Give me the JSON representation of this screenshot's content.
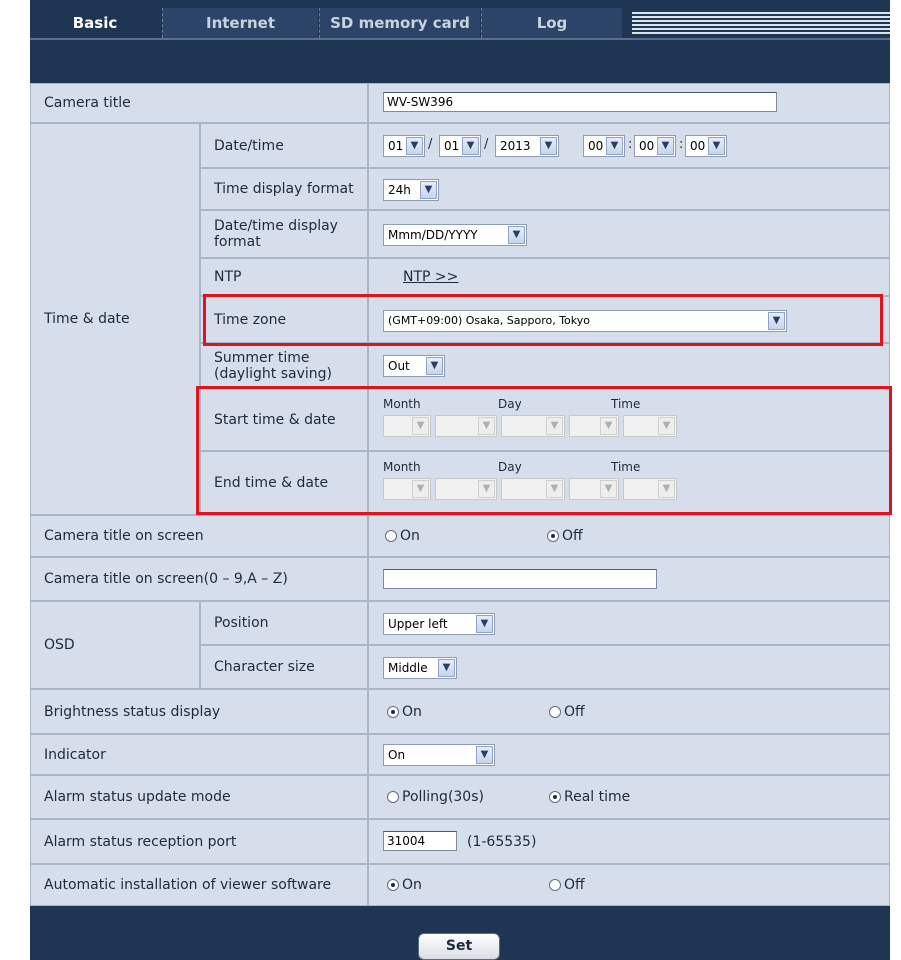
{
  "tabs": [
    "Basic",
    "Internet",
    "SD memory card",
    "Log"
  ],
  "rows": {
    "camera_title": {
      "label": "Camera title",
      "value": "WV-SW396"
    },
    "time_date": {
      "label": "Time & date",
      "datetime": {
        "label": "Date/time",
        "month": "01",
        "day": "01",
        "year": "2013",
        "hour": "00",
        "minute": "00",
        "second": "00",
        "slash": "/",
        "colon": ":"
      },
      "time_display_format": {
        "label": "Time display format",
        "value": "24h"
      },
      "datetime_display_format": {
        "label": "Date/time display format",
        "value": "Mmm/DD/YYYY"
      },
      "ntp": {
        "label": "NTP",
        "link": "NTP >>"
      },
      "time_zone": {
        "label": "Time zone",
        "value": "(GMT+09:00) Osaka, Sapporo, Tokyo"
      },
      "summer_time": {
        "label": "Summer time (daylight saving)",
        "value": "Out"
      },
      "start_time": {
        "label": "Start time & date",
        "month_label": "Month",
        "day_label": "Day",
        "time_label": "Time"
      },
      "end_time": {
        "label": "End time & date",
        "month_label": "Month",
        "day_label": "Day",
        "time_label": "Time"
      }
    },
    "title_on_screen": {
      "label": "Camera title on screen",
      "on": "On",
      "off": "Off",
      "selected": "off"
    },
    "title_on_screen_text": {
      "label": "Camera title on screen(0 – 9,A – Z)",
      "value": ""
    },
    "osd": {
      "label": "OSD",
      "position": {
        "label": "Position",
        "value": "Upper left"
      },
      "character_size": {
        "label": "Character size",
        "value": "Middle"
      }
    },
    "brightness": {
      "label": "Brightness status display",
      "on": "On",
      "off": "Off",
      "selected": "on"
    },
    "indicator": {
      "label": "Indicator",
      "value": "On"
    },
    "alarm_mode": {
      "label": "Alarm status update mode",
      "polling": "Polling(30s)",
      "realtime": "Real time",
      "selected": "realtime"
    },
    "alarm_port": {
      "label": "Alarm status reception port",
      "value": "31004",
      "range": "(1-65535)"
    },
    "auto_install": {
      "label": "Automatic installation of viewer software",
      "on": "On",
      "off": "Off",
      "selected": "on"
    }
  },
  "set_button": "Set",
  "colors": {
    "background": "#1f3554",
    "cell": "#d6deeb",
    "highlight": "#e0121c"
  },
  "icons": {
    "dropdown": "chevron-down-icon",
    "radio": "radio-icon"
  }
}
